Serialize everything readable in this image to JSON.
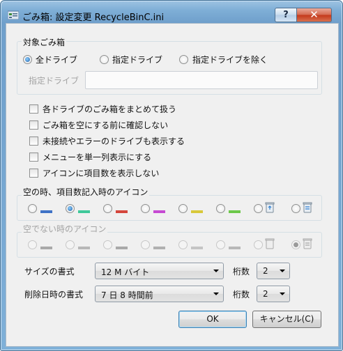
{
  "window": {
    "title": "ごみ箱: 設定変更  RecycleBinC.ini",
    "help_label": "?",
    "close_label": "✕"
  },
  "target": {
    "group_label": "対象ごみ箱",
    "options": [
      "全ドライブ",
      "指定ドライブ",
      "指定ドライブを除く"
    ],
    "selected": 0,
    "drive_label": "指定ドライブ",
    "drive_value": ""
  },
  "checkboxes": [
    "各ドライブのごみ箱をまとめて扱う",
    "ごみ箱を空にする前に確認しない",
    "未接続やエラーのドライブも表示する",
    "メニューを単一列表示にする",
    "アイコンに項目数を表示しない"
  ],
  "icons_empty": {
    "group_label": "空の時、項目数記入時のアイコン",
    "selected": 1,
    "swatch_colors": [
      "#3f72c6",
      "#3fc89a",
      "#d4463c",
      "#c64ad2",
      "#d8c83a",
      "#6cc84a"
    ]
  },
  "icons_full": {
    "group_label": "空でない時のアイコン",
    "selected": 7
  },
  "size_format": {
    "label": "サイズの書式",
    "value": "12 M バイト",
    "digits_label": "桁数",
    "digits_value": "2"
  },
  "date_format": {
    "label": "削除日時の書式",
    "value": "7 日 8 時間前",
    "digits_label": "桁数",
    "digits_value": "2"
  },
  "buttons": {
    "ok": "OK",
    "cancel": "キャンセル(C)"
  }
}
